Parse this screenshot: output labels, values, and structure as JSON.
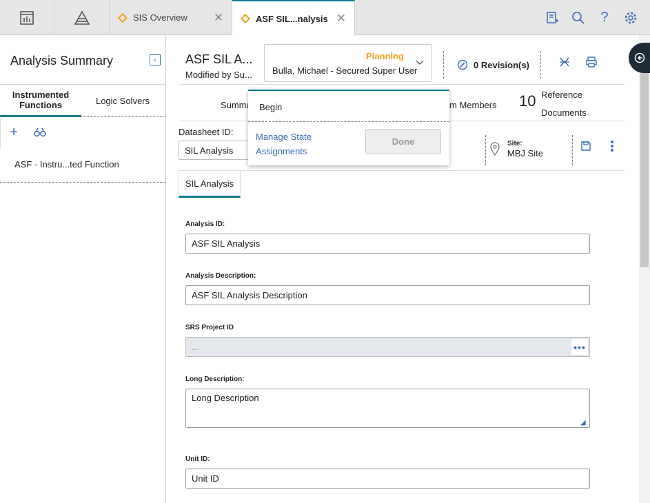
{
  "topbar": {
    "tabs": [
      {
        "label": "SIS Overview"
      },
      {
        "label": "ASF SIL...nalysis"
      }
    ],
    "icons": [
      "dashboard-icon",
      "pyramid-icon",
      "notes-icon",
      "search-icon",
      "help-icon",
      "gear-icon"
    ]
  },
  "left": {
    "title": "Analysis Summary",
    "tabs": [
      {
        "label": "Instrumented Functions"
      },
      {
        "label": "Logic Solvers"
      }
    ],
    "items": [
      {
        "label": "ASF - Instru...ted Function"
      }
    ]
  },
  "header": {
    "title": "ASF SIL A...",
    "subtitle": "Modified by Su...",
    "state": "Planning",
    "state_user": "Bulla, Michael - Secured Super User",
    "revisions": "0 Revision(s)"
  },
  "subtabs": {
    "summary": "Summa",
    "team": "m Members",
    "ref_count": "10",
    "ref_label_1": "Reference",
    "ref_label_2": "Documents"
  },
  "datasheet": {
    "label": "Datasheet ID:",
    "value": "SIL Analysis",
    "site_label": "Site:",
    "site_value": "MBJ Site"
  },
  "form": {
    "tab": "SIL Analysis",
    "analysis_id_label": "Analysis ID:",
    "analysis_id": "ASF SIL Analysis",
    "analysis_desc_label": "Analysis Description:",
    "analysis_desc": "ASF SIL Analysis Description",
    "srs_label": "SRS Project ID",
    "srs_value": "...",
    "long_desc_label": "Long Description:",
    "long_desc": "Long Description",
    "unit_id_label": "Unit ID:",
    "unit_id": "Unit ID"
  },
  "popup": {
    "begin": "Begin",
    "manage": "Manage State Assignments",
    "done": "Done"
  },
  "colors": {
    "accent": "#0b7c93",
    "link": "#3a6ab3",
    "state": "#f0a21e"
  }
}
